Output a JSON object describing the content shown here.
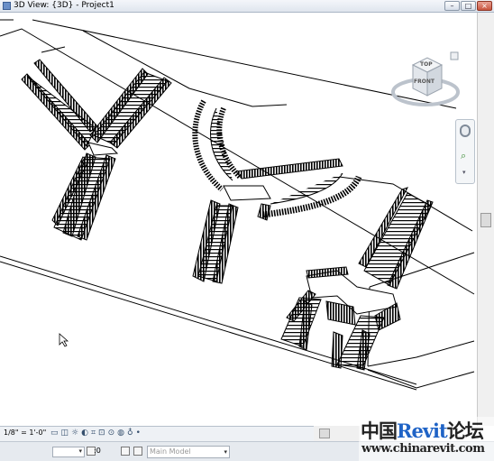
{
  "window": {
    "title": "3D View: {3D} - Project1",
    "buttons": {
      "minimize": "–",
      "restore": "□",
      "close": "×"
    }
  },
  "viewcube": {
    "top_label": "TOP",
    "front_label": "FRONT"
  },
  "statusbar": {
    "scale": "1/8\" = 1'-0\"",
    "tool_icons": [
      "visual-style-icon",
      "detail-level-icon",
      "sun-path-icon",
      "shadows-icon",
      "crop-icon",
      "show-crop-icon",
      "unlock-3d-icon",
      "temporary-hide-icon",
      "reveal-hidden-icon",
      "analytical-model-icon"
    ]
  },
  "optionsbar": {
    "selection_count": ":0",
    "model_selector": "Main Model"
  },
  "watermark": {
    "cn_left": "中国",
    "revit": "Revit",
    "cn_right": "论坛",
    "url": "www.chinarevit.com"
  },
  "colors": {
    "revit_blue": "#1f63c6",
    "line": "#000000"
  }
}
